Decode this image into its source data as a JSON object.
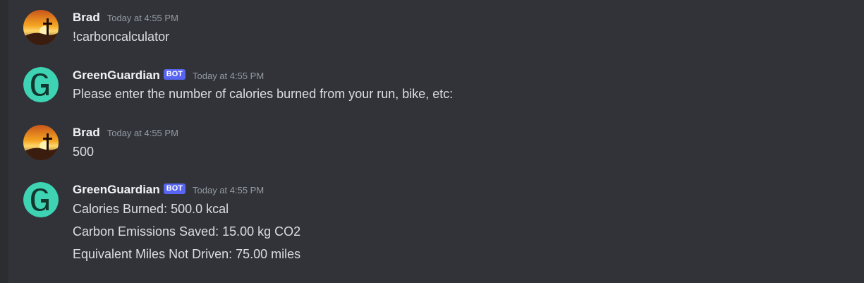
{
  "messages": [
    {
      "author": "Brad",
      "timestamp": "Today at 4:55 PM",
      "lines": [
        "!carboncalculator"
      ]
    },
    {
      "author": "GreenGuardian",
      "bot_tag": "BOT",
      "timestamp": "Today at 4:55 PM",
      "lines": [
        "Please enter the number of calories burned from your run, bike, etc:"
      ]
    },
    {
      "author": "Brad",
      "timestamp": "Today at 4:55 PM",
      "lines": [
        "500"
      ]
    },
    {
      "author": "GreenGuardian",
      "bot_tag": "BOT",
      "timestamp": "Today at 4:55 PM",
      "lines": [
        "Calories Burned: 500.0 kcal",
        "Carbon Emissions Saved: 15.00 kg CO2",
        "Equivalent Miles Not Driven: 75.00 miles"
      ]
    }
  ],
  "colors": {
    "background": "#313338",
    "username": "#f2f3f5",
    "message_text": "#dbdee1",
    "timestamp": "#949ba4",
    "bot_tag": "#5865f2",
    "bot_avatar": "#3dd3b3"
  },
  "icons": {
    "user_avatar": "sunset-cross-avatar",
    "bot_avatar": "green-g-logo-avatar"
  }
}
